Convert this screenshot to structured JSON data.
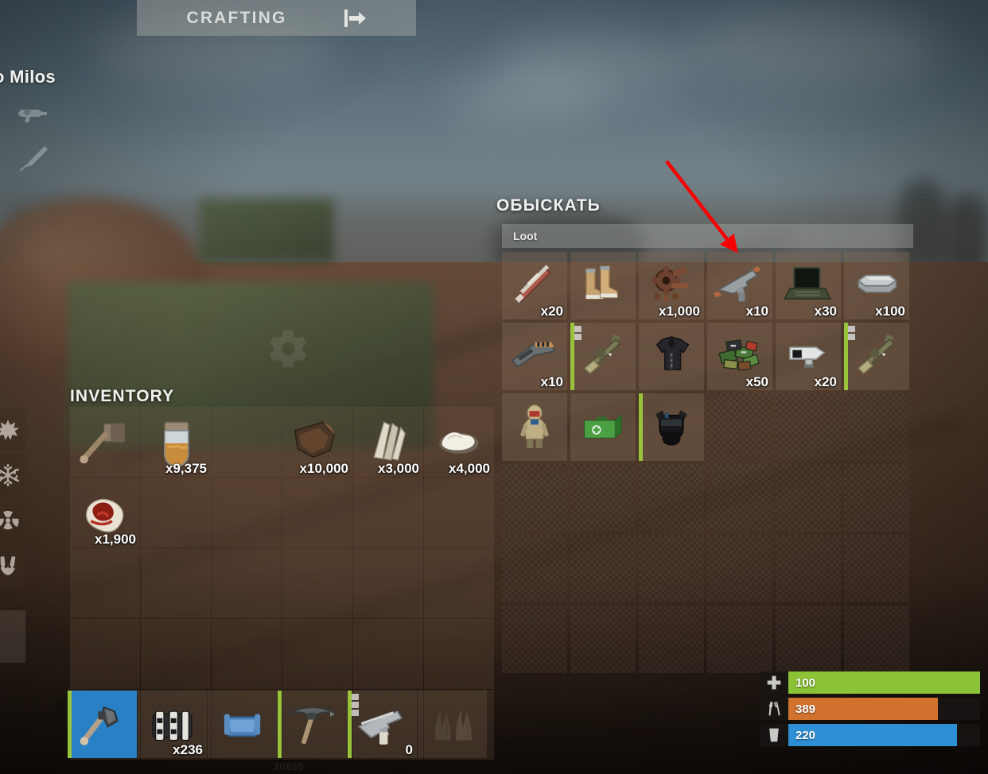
{
  "top_bar": {
    "crafting_tab_label": "CRAFTING",
    "exit_icon": "exit-arrow-icon"
  },
  "player": {
    "name": "o Milos",
    "weapon_icons": [
      "revolver-icon",
      "knife-icon"
    ]
  },
  "protection": {
    "icons": [
      "explosion-icon",
      "cold-icon",
      "radiation-icon",
      "bite-icon"
    ]
  },
  "inventory": {
    "title": "INVENTORY",
    "columns": 6,
    "rows": 5,
    "slots": [
      {
        "item": "sledgehammer",
        "qty": "",
        "art": "hammer",
        "condition": false
      },
      {
        "item": "jar-of-liquid",
        "qty": "x9,375",
        "art": "jar",
        "condition": false
      },
      {
        "item": "",
        "qty": "",
        "art": "",
        "condition": false
      },
      {
        "item": "leather",
        "qty": "x10,000",
        "art": "leather",
        "condition": false
      },
      {
        "item": "bone-fragments",
        "qty": "x3,000",
        "art": "bone",
        "condition": false
      },
      {
        "item": "cloth",
        "qty": "x4,000",
        "art": "cloth",
        "condition": false
      },
      {
        "item": "raw-meat",
        "qty": "x1,900",
        "art": "meat",
        "condition": false
      },
      {
        "item": "",
        "qty": "",
        "art": "",
        "condition": false
      },
      {
        "item": "",
        "qty": "",
        "art": "",
        "condition": false
      },
      {
        "item": "",
        "qty": "",
        "art": "",
        "condition": false
      },
      {
        "item": "",
        "qty": "",
        "art": "",
        "condition": false
      },
      {
        "item": "",
        "qty": "",
        "art": "",
        "condition": false
      },
      {
        "item": "",
        "qty": "",
        "art": "",
        "condition": false
      },
      {
        "item": "",
        "qty": "",
        "art": "",
        "condition": false
      },
      {
        "item": "",
        "qty": "",
        "art": "",
        "condition": false
      },
      {
        "item": "",
        "qty": "",
        "art": "",
        "condition": false
      },
      {
        "item": "",
        "qty": "",
        "art": "",
        "condition": false
      },
      {
        "item": "",
        "qty": "",
        "art": "",
        "condition": false
      },
      {
        "item": "",
        "qty": "",
        "art": "",
        "condition": false
      },
      {
        "item": "",
        "qty": "",
        "art": "",
        "condition": false
      },
      {
        "item": "",
        "qty": "",
        "art": "",
        "condition": false
      },
      {
        "item": "",
        "qty": "",
        "art": "",
        "condition": false
      },
      {
        "item": "",
        "qty": "",
        "art": "",
        "condition": false
      },
      {
        "item": "",
        "qty": "",
        "art": "",
        "condition": false
      },
      {
        "item": "",
        "qty": "",
        "art": "",
        "condition": false
      },
      {
        "item": "",
        "qty": "",
        "art": "",
        "condition": false
      },
      {
        "item": "",
        "qty": "",
        "art": "",
        "condition": false
      },
      {
        "item": "",
        "qty": "",
        "art": "",
        "condition": false
      },
      {
        "item": "",
        "qty": "",
        "art": "",
        "condition": false
      },
      {
        "item": "",
        "qty": "",
        "art": "",
        "condition": false
      }
    ]
  },
  "loot": {
    "title": "ОБЫСКАТЬ",
    "container_name": "Loot",
    "columns": 6,
    "rows": 6,
    "slots": [
      {
        "item": "explosive-charge",
        "qty": "x20",
        "art": "charge",
        "condition": false,
        "attachments": 0
      },
      {
        "item": "boots",
        "qty": "",
        "art": "boots",
        "condition": false,
        "attachments": 0
      },
      {
        "item": "gears",
        "qty": "x1,000",
        "art": "gears",
        "condition": false,
        "attachments": 0
      },
      {
        "item": "pistol",
        "qty": "x10",
        "art": "pistol",
        "condition": false,
        "attachments": 0
      },
      {
        "item": "laptop",
        "qty": "x30",
        "art": "laptop",
        "condition": false,
        "attachments": 0
      },
      {
        "item": "metal-ingot",
        "qty": "x100",
        "art": "ingot",
        "condition": false,
        "attachments": 0
      },
      {
        "item": "chainsaw",
        "qty": "x10",
        "art": "chainsaw",
        "condition": false,
        "attachments": 0
      },
      {
        "item": "rifle",
        "qty": "",
        "art": "rifle",
        "condition": true,
        "attachments": 2
      },
      {
        "item": "jacket",
        "qty": "",
        "art": "jacket",
        "condition": false,
        "attachments": 0
      },
      {
        "item": "electronics",
        "qty": "x50",
        "art": "circuits",
        "condition": false,
        "attachments": 0
      },
      {
        "item": "cctv-camera",
        "qty": "x20",
        "art": "cctv",
        "condition": false,
        "attachments": 0
      },
      {
        "item": "rifle",
        "qty": "",
        "art": "rifle",
        "condition": true,
        "attachments": 2
      },
      {
        "item": "hazmat-suit",
        "qty": "",
        "art": "hazmat",
        "condition": false,
        "attachments": 0
      },
      {
        "item": "medical-crate",
        "qty": "",
        "art": "medbox",
        "condition": false,
        "attachments": 0
      },
      {
        "item": "helmet",
        "qty": "",
        "art": "helmet",
        "condition": true,
        "attachments": 0
      },
      {
        "item": "",
        "qty": "",
        "art": "",
        "condition": false,
        "attachments": 0
      },
      {
        "item": "",
        "qty": "",
        "art": "",
        "condition": false,
        "attachments": 0
      },
      {
        "item": "",
        "qty": "",
        "art": "",
        "condition": false,
        "attachments": 0
      },
      {
        "item": "",
        "qty": "",
        "art": "",
        "condition": false,
        "attachments": 0
      },
      {
        "item": "",
        "qty": "",
        "art": "",
        "condition": false,
        "attachments": 0
      },
      {
        "item": "",
        "qty": "",
        "art": "",
        "condition": false,
        "attachments": 0
      },
      {
        "item": "",
        "qty": "",
        "art": "",
        "condition": false,
        "attachments": 0
      },
      {
        "item": "",
        "qty": "",
        "art": "",
        "condition": false,
        "attachments": 0
      },
      {
        "item": "",
        "qty": "",
        "art": "",
        "condition": false,
        "attachments": 0
      },
      {
        "item": "",
        "qty": "",
        "art": "",
        "condition": false,
        "attachments": 0
      },
      {
        "item": "",
        "qty": "",
        "art": "",
        "condition": false,
        "attachments": 0
      },
      {
        "item": "",
        "qty": "",
        "art": "",
        "condition": false,
        "attachments": 0
      },
      {
        "item": "",
        "qty": "",
        "art": "",
        "condition": false,
        "attachments": 0
      },
      {
        "item": "",
        "qty": "",
        "art": "",
        "condition": false,
        "attachments": 0
      },
      {
        "item": "",
        "qty": "",
        "art": "",
        "condition": false,
        "attachments": 0
      },
      {
        "item": "",
        "qty": "",
        "art": "",
        "condition": false,
        "attachments": 0
      },
      {
        "item": "",
        "qty": "",
        "art": "",
        "condition": false,
        "attachments": 0
      },
      {
        "item": "",
        "qty": "",
        "art": "",
        "condition": false,
        "attachments": 0
      },
      {
        "item": "",
        "qty": "",
        "art": "",
        "condition": false,
        "attachments": 0
      },
      {
        "item": "",
        "qty": "",
        "art": "",
        "condition": false,
        "attachments": 0
      },
      {
        "item": "",
        "qty": "",
        "art": "",
        "condition": false,
        "attachments": 0
      }
    ]
  },
  "hotbar": {
    "slots": [
      {
        "item": "hatchet",
        "qty": "",
        "art": "hatchet",
        "condition": true,
        "selected": true,
        "attachments": 0
      },
      {
        "item": "explosives",
        "qty": "x236",
        "art": "explosive",
        "condition": false,
        "selected": false,
        "attachments": 0
      },
      {
        "item": "blue-item",
        "qty": "",
        "art": "blueitem",
        "condition": false,
        "selected": false,
        "attachments": 0
      },
      {
        "item": "pickaxe",
        "qty": "",
        "art": "pickaxe",
        "condition": true,
        "selected": false,
        "attachments": 0
      },
      {
        "item": "pistol",
        "qty": "0",
        "art": "pistol2",
        "condition": true,
        "selected": false,
        "attachments": 3
      },
      {
        "item": "dried-plants",
        "qty": "",
        "art": "plants",
        "condition": false,
        "selected": false,
        "attachments": 0
      }
    ]
  },
  "status": {
    "health": {
      "icon": "health-cross-icon",
      "value": "100",
      "percent": 100,
      "color": "#8cc235"
    },
    "hunger": {
      "icon": "food-icon",
      "value": "389",
      "percent": 78,
      "color": "#d2722f"
    },
    "thirst": {
      "icon": "water-glass-icon",
      "value": "220",
      "percent": 88,
      "color": "#2f8fd4"
    }
  },
  "watermark": {
    "seed": "30885"
  },
  "annotation": {
    "arrow_color": "#f80000",
    "target": "pistol loot slot"
  }
}
